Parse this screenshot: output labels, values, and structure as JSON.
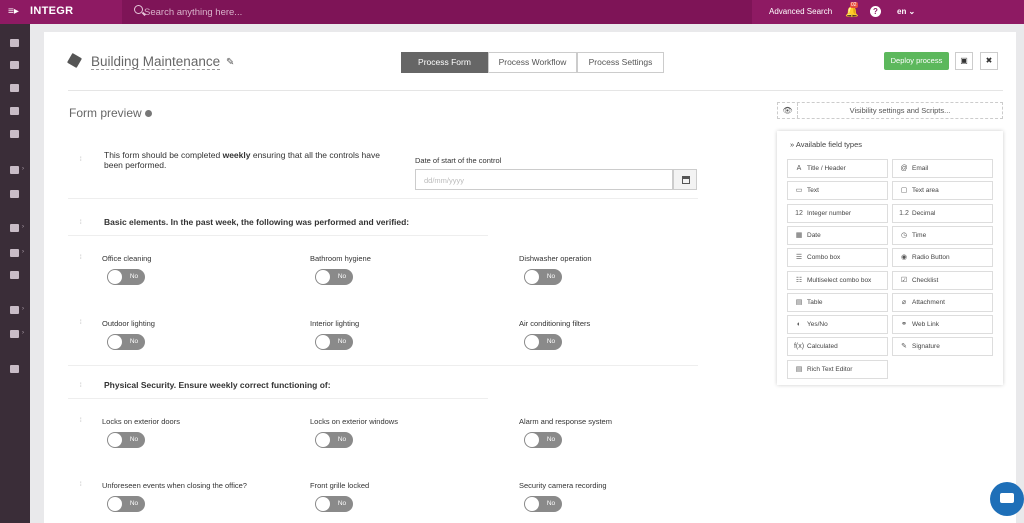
{
  "topbar": {
    "menu_icon": "hamburger-icon",
    "logo": "INTEGR",
    "search_placeholder": "Search anything here...",
    "advanced_search": "Advanced Search",
    "notifications_badge": "02",
    "help": "?",
    "language": "en ⌄"
  },
  "page": {
    "title": "Building Maintenance",
    "tabs": [
      "Process Form",
      "Process Workflow",
      "Process Settings"
    ],
    "active_tab": "Process Form",
    "deploy": "Deploy process",
    "save_icon": "floppy-disk-icon",
    "close_icon": "close-icon"
  },
  "preview": {
    "title": "Form preview",
    "visibility_btn": "Visibility settings and Scripts..."
  },
  "form": {
    "intro_prefix": "This form should be completed ",
    "intro_bold": "weekly",
    "intro_suffix": " ensuring that all the controls have been performed.",
    "date_label": "Date of start of the control",
    "date_placeholder": "dd/mm/yyyy",
    "section1": "Basic elements. In the past week, the following was performed and verified:",
    "section2": "Physical Security. Ensure weekly correct functioning of:",
    "toggle_off": "No",
    "items": [
      "Office cleaning",
      "Bathroom hygiene",
      "Dishwasher operation",
      "Outdoor lighting",
      "Interior lighting",
      "Air conditioning filters",
      "Locks on exterior doors",
      "Locks on exterior windows",
      "Alarm and response system",
      "Unforeseen events when closing the office?",
      "Front grille locked",
      "Security camera recording"
    ]
  },
  "fieldtypes": {
    "header": "» Available field types",
    "items": [
      {
        "label": "Title / Header",
        "icon": "A"
      },
      {
        "label": "Email",
        "icon": "@"
      },
      {
        "label": "Text",
        "icon": "▭"
      },
      {
        "label": "Text area",
        "icon": "▢"
      },
      {
        "label": "Integer number",
        "icon": "12"
      },
      {
        "label": "Decimal",
        "icon": "1.2"
      },
      {
        "label": "Date",
        "icon": "▦"
      },
      {
        "label": "Time",
        "icon": "◷"
      },
      {
        "label": "Combo box",
        "icon": "☰"
      },
      {
        "label": "Radio Button",
        "icon": "◉"
      },
      {
        "label": "Multiselect combo box",
        "icon": "☷"
      },
      {
        "label": "Checklist",
        "icon": "☑"
      },
      {
        "label": "Table",
        "icon": "▤"
      },
      {
        "label": "Attachment",
        "icon": "⌀"
      },
      {
        "label": "Yes/No",
        "icon": "◐"
      },
      {
        "label": "Web Link",
        "icon": "⚭"
      },
      {
        "label": "Calculated",
        "icon": "f(x)"
      },
      {
        "label": "Signature",
        "icon": "✎"
      },
      {
        "label": "Rich Text Editor",
        "icon": "▤"
      }
    ]
  }
}
